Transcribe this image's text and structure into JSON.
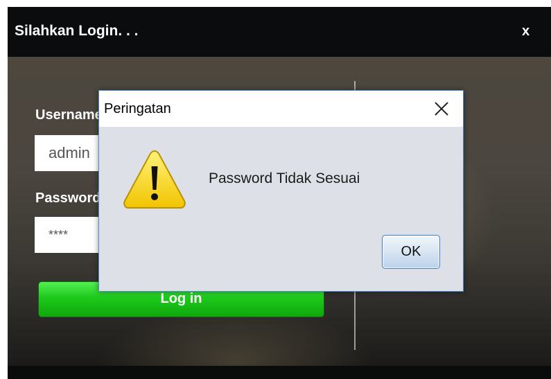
{
  "window": {
    "title": "Silahkan Login. . .",
    "close_label": "x"
  },
  "form": {
    "username_label": "Username",
    "username_value": "admin",
    "password_label": "Password",
    "password_value": "****",
    "login_label": "Log in"
  },
  "dialog": {
    "title": "Peringatan",
    "message": "Password Tidak Sesuai",
    "ok_label": "OK",
    "icon": "warning-icon"
  },
  "colors": {
    "login_button": "#1ec91c",
    "dialog_border": "#4a8fd8",
    "titlebar": "#0a0c0d"
  }
}
